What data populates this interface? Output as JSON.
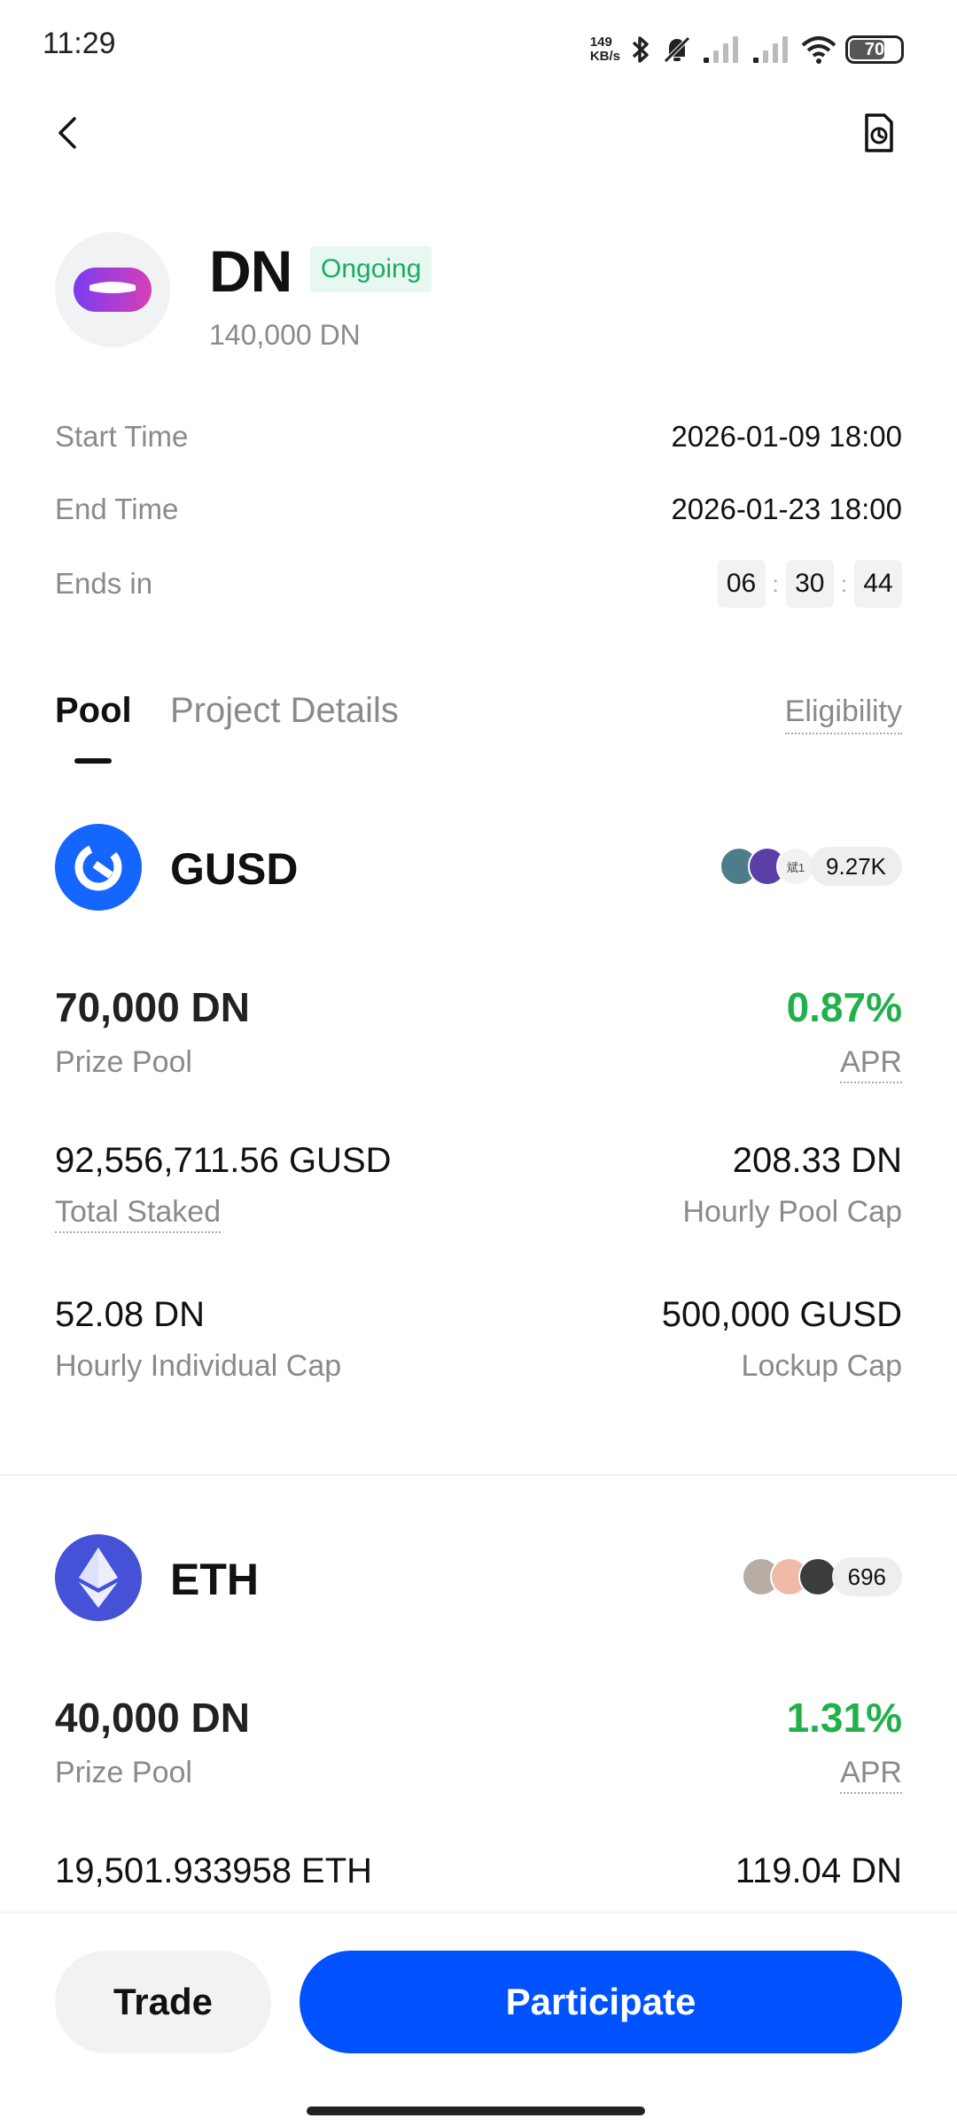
{
  "status": {
    "time": "11:29",
    "net_speed_value": "149",
    "net_speed_unit": "KB/s",
    "battery": "70"
  },
  "token": {
    "name": "DN",
    "status_badge": "Ongoing",
    "amount": "140,000 DN"
  },
  "info": {
    "start_label": "Start Time",
    "start_value": "2026-01-09 18:00",
    "end_label": "End Time",
    "end_value": "2026-01-23 18:00",
    "ends_in_label": "Ends in",
    "countdown": [
      "06",
      "30",
      "44"
    ]
  },
  "tabs": {
    "pool": "Pool",
    "project_details": "Project Details",
    "eligibility": "Eligibility"
  },
  "pools": [
    {
      "name": "GUSD",
      "participants": "9.27K",
      "avatar_note": "斌1",
      "prize_pool_value": "70,000 DN",
      "prize_pool_label": "Prize Pool",
      "apr_value": "0.87%",
      "apr_label": "APR",
      "total_staked_value": "92,556,711.56 GUSD",
      "total_staked_label": "Total Staked",
      "hourly_pool_cap_value": "208.33 DN",
      "hourly_pool_cap_label": "Hourly Pool Cap",
      "hourly_individual_cap_value": "52.08 DN",
      "hourly_individual_cap_label": "Hourly Individual Cap",
      "lockup_cap_value": "500,000 GUSD",
      "lockup_cap_label": "Lockup Cap"
    },
    {
      "name": "ETH",
      "participants": "696",
      "prize_pool_value": "40,000 DN",
      "prize_pool_label": "Prize Pool",
      "apr_value": "1.31%",
      "apr_label": "APR",
      "total_staked_value": "19,501.933958 ETH",
      "hourly_pool_cap_value": "119.04 DN"
    }
  ],
  "actions": {
    "trade": "Trade",
    "participate": "Participate"
  },
  "colors": {
    "accent": "#0052ff",
    "positive": "#22b04b",
    "badge_text": "#1aab66",
    "badge_bg": "#e6f8ef"
  }
}
